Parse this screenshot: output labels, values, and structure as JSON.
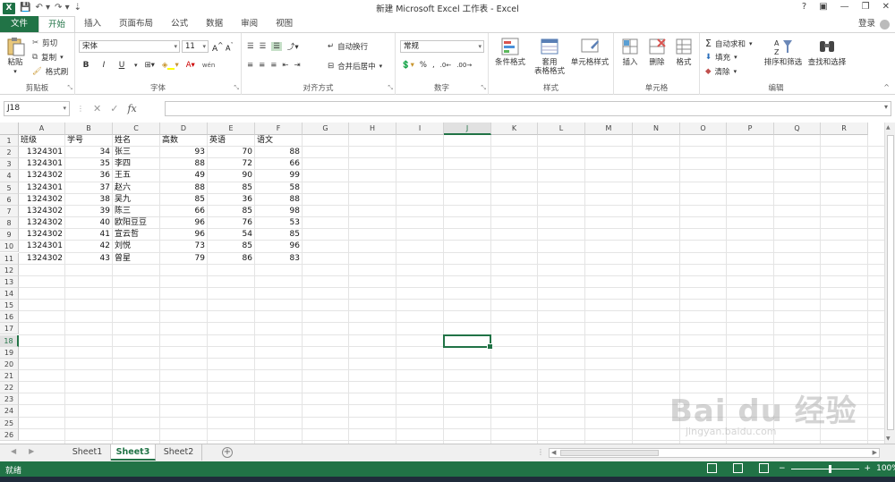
{
  "window": {
    "title": "新建 Microsoft Excel 工作表 - Excel",
    "controls": [
      "?",
      "▣",
      "—",
      "❐",
      "✕"
    ],
    "login": "登录"
  },
  "quick_access": [
    "save-icon",
    "undo-icon",
    "redo-icon",
    "customize-icon"
  ],
  "ribbon_tabs": [
    "文件",
    "开始",
    "插入",
    "页面布局",
    "公式",
    "数据",
    "审阅",
    "视图"
  ],
  "active_tab": "开始",
  "ribbon": {
    "clipboard": {
      "paste": "粘贴",
      "cut": "剪切",
      "copy": "复制",
      "format_painter": "格式刷",
      "label": "剪贴板"
    },
    "font": {
      "name": "宋体",
      "size": "11",
      "bold": "B",
      "italic": "I",
      "underline": "U",
      "grow": "A",
      "shrink": "A",
      "phonetic": "wén",
      "label": "字体"
    },
    "alignment": {
      "wrap": "自动换行",
      "merge": "合并后居中",
      "label": "对齐方式"
    },
    "number": {
      "format": "常规",
      "percent": "%",
      "comma": ",",
      "inc_decimal": ".0\n.00",
      "dec_decimal": ".00\n.0",
      "label": "数字"
    },
    "styles": {
      "conditional": "条件格式",
      "table_1": "套用",
      "table_2": "表格格式",
      "cell_styles": "单元格样式",
      "label": "样式"
    },
    "cells": {
      "insert": "插入",
      "delete": "删除",
      "format": "格式",
      "label": "单元格"
    },
    "editing": {
      "autosum": "自动求和",
      "fill": "填充",
      "clear": "清除",
      "sort": "排序和筛选",
      "find": "查找和选择",
      "label": "编辑"
    }
  },
  "formula_bar": {
    "name_box": "J18",
    "fx": "fx",
    "content": ""
  },
  "columns": [
    "A",
    "B",
    "C",
    "D",
    "E",
    "F",
    "G",
    "H",
    "I",
    "J",
    "K",
    "L",
    "M",
    "N",
    "O",
    "P",
    "Q",
    "R"
  ],
  "selected_column": "J",
  "rows": [
    "1",
    "2",
    "3",
    "4",
    "5",
    "6",
    "7",
    "8",
    "9",
    "10",
    "11",
    "12",
    "13",
    "14",
    "15",
    "16",
    "17",
    "18",
    "19",
    "20",
    "21",
    "22",
    "23",
    "24",
    "25",
    "26"
  ],
  "selected_row": "18",
  "table": {
    "header": [
      "班级",
      "学号",
      "姓名",
      "高数",
      "英语",
      "语文"
    ],
    "records": [
      [
        "1324301",
        "34",
        "张三",
        "93",
        "70",
        "88"
      ],
      [
        "1324301",
        "35",
        "李四",
        "88",
        "72",
        "66"
      ],
      [
        "1324302",
        "36",
        "王五",
        "49",
        "90",
        "99"
      ],
      [
        "1324301",
        "37",
        "赵六",
        "88",
        "85",
        "58"
      ],
      [
        "1324302",
        "38",
        "吴九",
        "85",
        "36",
        "88"
      ],
      [
        "1324302",
        "39",
        "陈三",
        "66",
        "85",
        "98"
      ],
      [
        "1324302",
        "40",
        "欧阳豆豆",
        "96",
        "76",
        "53"
      ],
      [
        "1324302",
        "41",
        "宣云哲",
        "96",
        "54",
        "85"
      ],
      [
        "1324301",
        "42",
        "刘悦",
        "73",
        "85",
        "96"
      ],
      [
        "1324302",
        "43",
        "曾星",
        "79",
        "86",
        "83"
      ]
    ]
  },
  "sheet_tabs": [
    "Sheet1",
    "Sheet3",
    "Sheet2"
  ],
  "active_sheet": "Sheet3",
  "status": {
    "ready": "就绪",
    "zoom": "100%"
  },
  "watermark": {
    "brand": "Bai du 经验",
    "url": "jingyan.baidu.com"
  },
  "colors": {
    "accent": "#217346",
    "header_bg": "#f3f3f3",
    "grid": "#e4e4e4"
  }
}
